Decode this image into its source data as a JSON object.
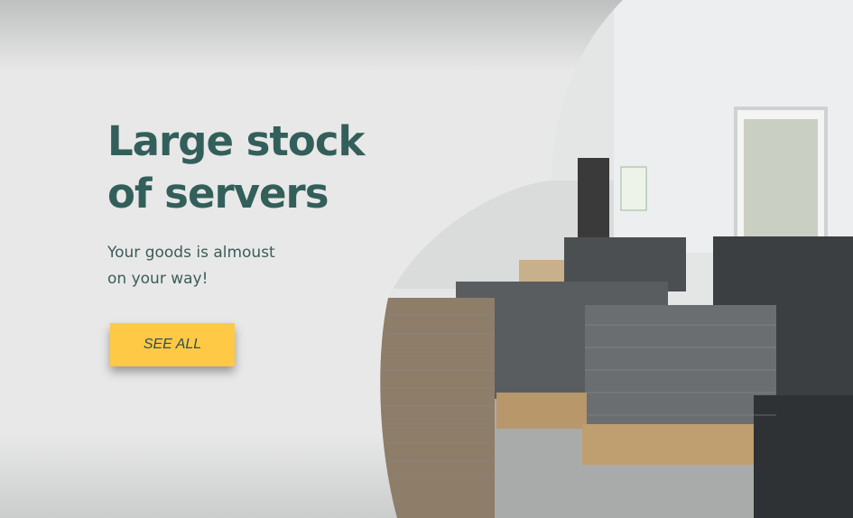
{
  "hero": {
    "title_line1": "Large stock",
    "title_line2": "of servers",
    "subtitle_line1": "Your goods is almoust",
    "subtitle_line2": "on your way!",
    "cta_label": "SEE ALL"
  },
  "colors": {
    "title": "#335f5a",
    "button": "#fec944",
    "background": "#e8e8e8"
  },
  "image": {
    "subject": "warehouse with stacked servers on pallets"
  }
}
